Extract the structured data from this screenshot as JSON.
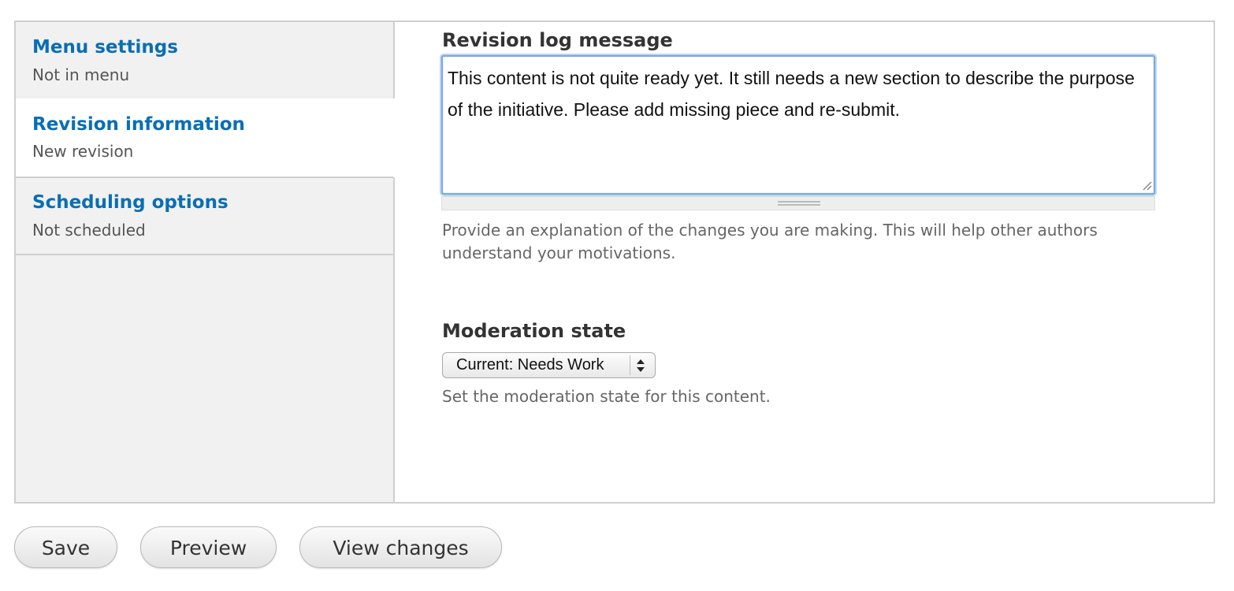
{
  "vertical_tabs": [
    {
      "title": "Menu settings",
      "summary": "Not in menu"
    },
    {
      "title": "Revision information",
      "summary": "New revision"
    },
    {
      "title": "Scheduling options",
      "summary": "Not scheduled"
    }
  ],
  "revision": {
    "label": "Revision log message",
    "value": "This content is not quite ready yet. It still needs a new section to describe the purpose of the initiative. Please add missing piece and re-submit.",
    "description": "Provide an explanation of the changes you are making. This will help other authors understand your motivations."
  },
  "moderation": {
    "label": "Moderation state",
    "selected": "Current: Needs Work",
    "description": "Set the moderation state for this content."
  },
  "actions": {
    "save_label": "Save",
    "preview_label": "Preview",
    "view_changes_label": "View changes"
  },
  "colors": {
    "link_blue": "#0a6eb4",
    "tab_background": "#f1f1f1",
    "focus_ring": "#7aa9dc"
  }
}
